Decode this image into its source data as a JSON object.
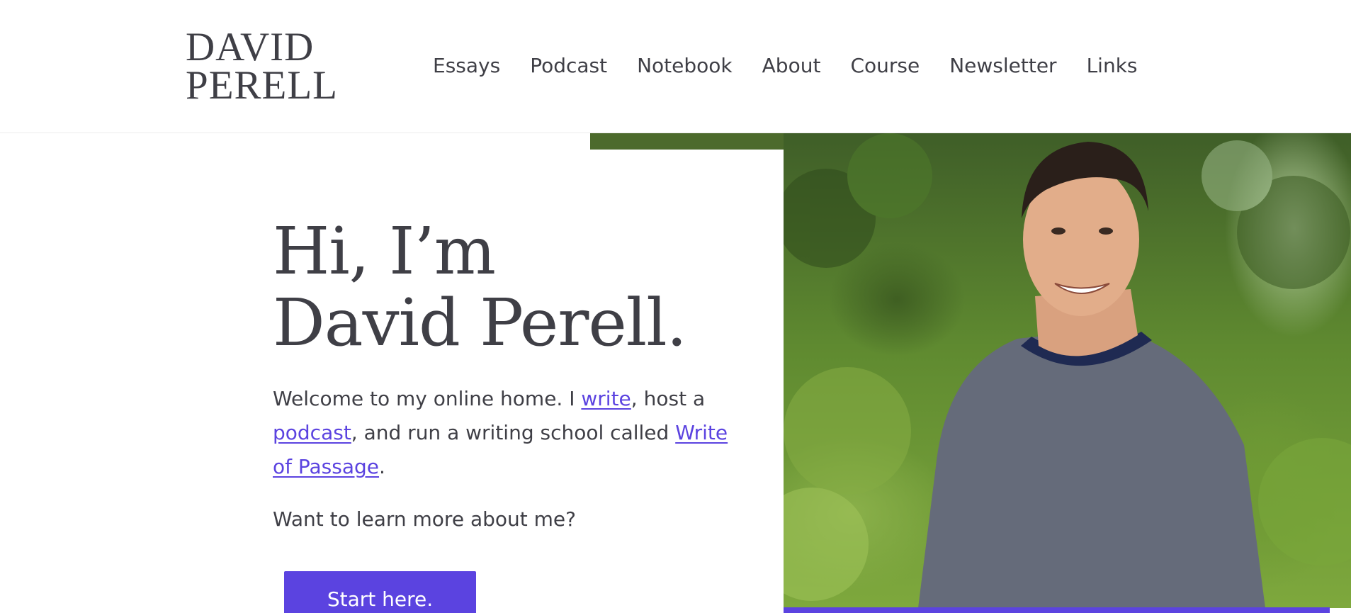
{
  "header": {
    "logo_line1": "DAVID",
    "logo_line2": "PERELL",
    "nav": [
      "Essays",
      "Podcast",
      "Notebook",
      "About",
      "Course",
      "Newsletter",
      "Links"
    ]
  },
  "hero": {
    "title": "Hi, I’m David Perell.",
    "intro": {
      "t1": "Welcome to my online home. I ",
      "link_write": "write",
      "t2": ", host a ",
      "link_podcast": "podcast",
      "t3": ", and run a writing school called ",
      "link_school": "Write of Passage",
      "t4": "."
    },
    "question": "Want to learn more about me?",
    "cta_label": "Start here.",
    "photo_icon": "portrait-photo"
  },
  "colors": {
    "accent": "#5b43e0",
    "text": "#3f3f46",
    "background": "#ffffff"
  }
}
